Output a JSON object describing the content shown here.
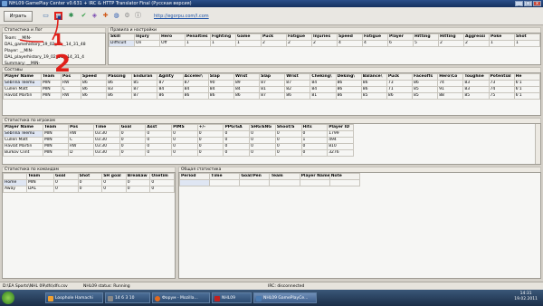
{
  "window": {
    "title": "NHL09 GamePlay Center v0.631 + IRC & HTTP Translator Final (Русская версия)",
    "min": "_",
    "max": "□",
    "close": "x"
  },
  "toolbar": {
    "play_label": "Играть",
    "url": "http://egorpu.com/l.com"
  },
  "stats_log": {
    "title": "Статистика и Лог",
    "rows": [
      {
        "label": "Team:",
        "value": "__MIN-DAL_gamehistory_19_02_11__14_31_48"
      },
      {
        "label": "Player:",
        "value": "__MIN-DAL_playerhistory_19_02_11__14_31_4"
      },
      {
        "label": "Summary:",
        "value": "__MIN-DAL_gamestat_19_02_11__14_31_5"
      },
      {
        "label": "Log:",
        "value": ""
      }
    ]
  },
  "rules": {
    "title": "Правила и настройки",
    "headers": [
      "Skill",
      "Injury",
      "Hero",
      "Penalties",
      "Fighting",
      "Game",
      "Puck",
      "Fatigue",
      "Injuries",
      "Speed",
      "Fatigue",
      "Player",
      "Hitting",
      "Hitting",
      "Aggressi",
      "Poke",
      "Shot"
    ],
    "row": [
      "Difficult",
      "On",
      "Off",
      "1",
      "1",
      "1",
      "2",
      "2",
      "2",
      "4",
      "4",
      "6",
      "5",
      "2",
      "2",
      "1",
      "1"
    ]
  },
  "rosters": {
    "title": "Составы",
    "headers": [
      "Player Name",
      "Team",
      "Pos",
      "Speed",
      "Passing",
      "Enduran",
      "Agility",
      "Acceler\\",
      "Slap",
      "Wrist",
      "Slap",
      "Wrist",
      "Cheking\\",
      "Deking\\",
      "Balance\\",
      "Puck",
      "Faceoffs",
      "Hero\\Co",
      "Toughne",
      "Potential",
      "He"
    ],
    "rows": [
      [
        "Sebrina Teemu",
        "MIN",
        "RW",
        "86",
        "86",
        "85",
        "87",
        "87",
        "90",
        "89",
        "87",
        "87",
        "84",
        "86",
        "86",
        "73",
        "86",
        "74",
        "83",
        "73",
        "6'1"
      ],
      [
        "Cullen Matt",
        "MIN",
        "C",
        "86",
        "83",
        "87",
        "84",
        "84",
        "84",
        "84",
        "81",
        "82",
        "84",
        "86",
        "86",
        "71",
        "85",
        "91",
        "83",
        "74",
        "6'1"
      ],
      [
        "Havlat Martin",
        "MIN",
        "RW",
        "86",
        "86",
        "87",
        "86",
        "86",
        "86",
        "86",
        "87",
        "86",
        "81",
        "86",
        "85",
        "86",
        "85",
        "88",
        "85",
        "75",
        "6'1"
      ]
    ]
  },
  "player_stats": {
    "title": "Статистика по игрокам",
    "headers": [
      "Player Name",
      "Team",
      "Pos",
      "Time",
      "Goal",
      "Asst",
      "PIMS",
      "+/-",
      "PPG/GA",
      "SHG/ENG",
      "Shoot/S",
      "Hits",
      "Player ID"
    ],
    "rows": [
      [
        "Sebrina Teemu",
        "MIN",
        "RW",
        "03:30",
        "0",
        "0",
        "0",
        "0",
        "0",
        "0",
        "0",
        "0",
        "1799"
      ],
      [
        "Cullen Matt",
        "MIN",
        "C",
        "03:30",
        "0",
        "0",
        "0",
        "0",
        "0",
        "0",
        "0",
        "1",
        "494"
      ],
      [
        "Havlat Martin",
        "MIN",
        "RW",
        "03:30",
        "0",
        "0",
        "0",
        "0",
        "0",
        "0",
        "0",
        "0",
        "810"
      ],
      [
        "Burkov Clint",
        "MIN",
        "D",
        "03:30",
        "0",
        "0",
        "0",
        "0",
        "0",
        "0",
        "0",
        "0",
        "3276"
      ]
    ]
  },
  "team_stats": {
    "title": "Статистика по командам",
    "headers": [
      "Team",
      "Goal",
      "Shot",
      "SH goal",
      "Breakaw",
      "Onetim"
    ],
    "rows": [
      [
        "Home",
        "MIN",
        "0",
        "0",
        "0",
        "0",
        "0"
      ],
      [
        "Away",
        "DAL",
        "0",
        "0",
        "0",
        "0",
        "0"
      ]
    ]
  },
  "general_stats": {
    "title": "Общая статистика",
    "headers": [
      "Period",
      "Time",
      "Goal/Pen",
      "Team",
      "Player Name",
      "Note"
    ]
  },
  "status": {
    "path": "D:\\EA Sports\\NHL 09\\dfs\\dfs.csv",
    "nhl": "NHL09 status: Running",
    "irc": "IRC: disconnected"
  },
  "taskbar": {
    "tasks": [
      {
        "label": "Loophole Hamachi",
        "color": "#f0a030"
      },
      {
        "label": "14 6 3 10",
        "color": "#888888"
      },
      {
        "label": "Форум - Mozilla...",
        "color": "#e06a20"
      },
      {
        "label": "NHL09",
        "color": "#c02020"
      },
      {
        "label": "NHL09 GamePlayCe...",
        "color": "#4a7ab0"
      }
    ],
    "time": "14:31",
    "date": "19.02.2011"
  },
  "annotations": {
    "one": "1",
    "two": "2"
  },
  "colors": {
    "title_bg": "#15305e",
    "highlight": "#e0201a",
    "link": "#1d52a6"
  }
}
